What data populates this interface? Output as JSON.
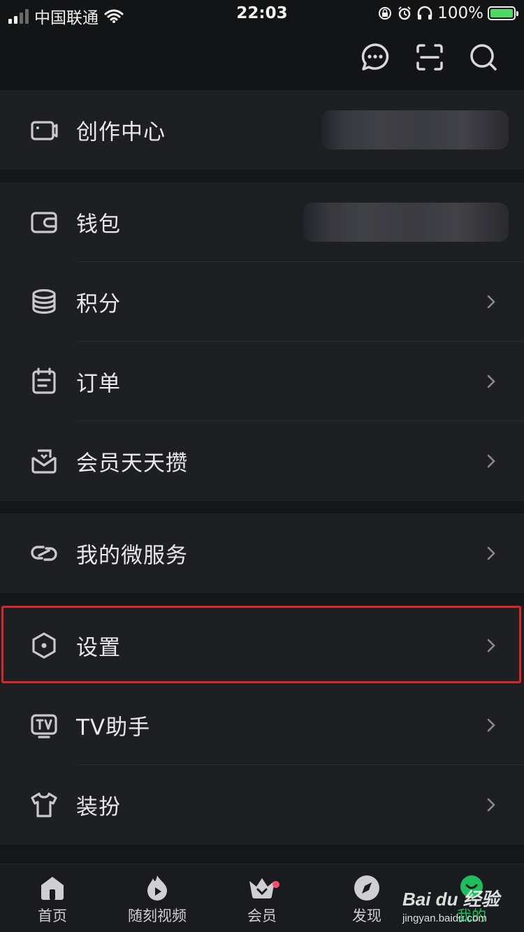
{
  "status_bar": {
    "carrier": "中国联通",
    "time": "22:03",
    "battery": "100%"
  },
  "top_bar": {
    "icons": [
      "message-icon",
      "scan-icon",
      "search-icon"
    ]
  },
  "groups": [
    {
      "items": [
        {
          "label": "创作中心",
          "icon": "video-camera-icon",
          "value_blurred": true
        }
      ]
    },
    {
      "items": [
        {
          "label": "钱包",
          "icon": "wallet-icon",
          "value_blurred": true
        },
        {
          "label": "积分",
          "icon": "coins-stack-icon"
        },
        {
          "label": "订单",
          "icon": "order-calendar-icon"
        },
        {
          "label": "会员天天攒",
          "icon": "gift-box-icon"
        }
      ]
    },
    {
      "items": [
        {
          "label": "我的微服务",
          "icon": "link-icon"
        }
      ]
    },
    {
      "items": [
        {
          "label": "设置",
          "icon": "hexagon-settings-icon",
          "highlighted": true
        },
        {
          "label": "TV助手",
          "icon": "tv-icon"
        },
        {
          "label": "装扮",
          "icon": "tshirt-icon"
        }
      ]
    }
  ],
  "tabs": [
    {
      "label": "首页",
      "icon": "home-icon"
    },
    {
      "label": "随刻视频",
      "icon": "flame-play-icon"
    },
    {
      "label": "会员",
      "icon": "crown-icon",
      "badge": true
    },
    {
      "label": "发现",
      "icon": "compass-icon"
    },
    {
      "label": "我的",
      "icon": "profile-icon",
      "active": true
    }
  ],
  "watermark": {
    "main": "Bai du 经验",
    "sub": "jingyan.baidu.com"
  },
  "colors": {
    "accent": "#1dbe5b",
    "highlight": "#d8272a",
    "background": "#161719",
    "row_bg": "#1e1f23"
  }
}
